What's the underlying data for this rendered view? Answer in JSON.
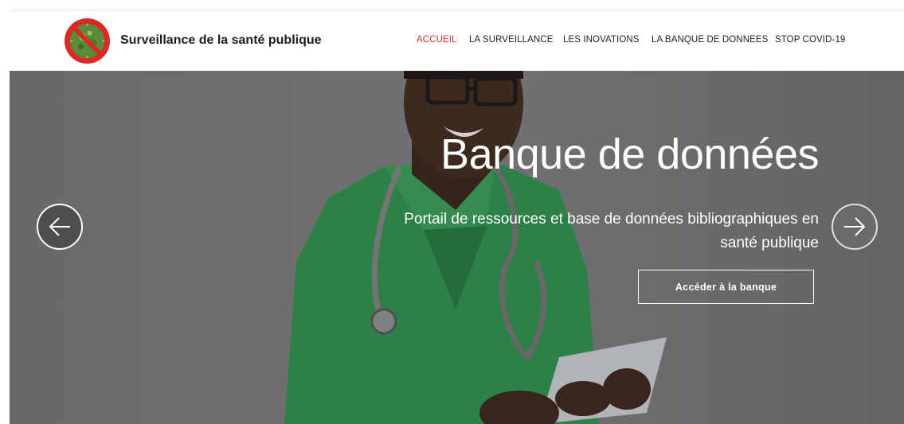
{
  "header": {
    "site_title": "Surveillance de la santé publique",
    "logo_icon": "no-virus-icon"
  },
  "nav": {
    "items": [
      {
        "label": "ACCUEIL",
        "active": true
      },
      {
        "label": "LA SURVEILLANCE",
        "active": false
      },
      {
        "label": "LES INOVATIONS",
        "active": false
      },
      {
        "label": "LA BANQUE DE DONNEES",
        "active": false
      },
      {
        "label": "STOP COVID-19",
        "active": false
      }
    ]
  },
  "hero": {
    "title": "Banque de données",
    "subtitle": "Portail de ressources et base de données bibliographiques en santé publique",
    "button_label": "Accéder à la banque",
    "prev_icon": "arrow-left-icon",
    "next_icon": "arrow-right-icon"
  },
  "colors": {
    "accent": "#d3322a",
    "nav_text": "#222222",
    "hero_overlay": "#7d7e80",
    "scrubs": "#2f9a51"
  }
}
